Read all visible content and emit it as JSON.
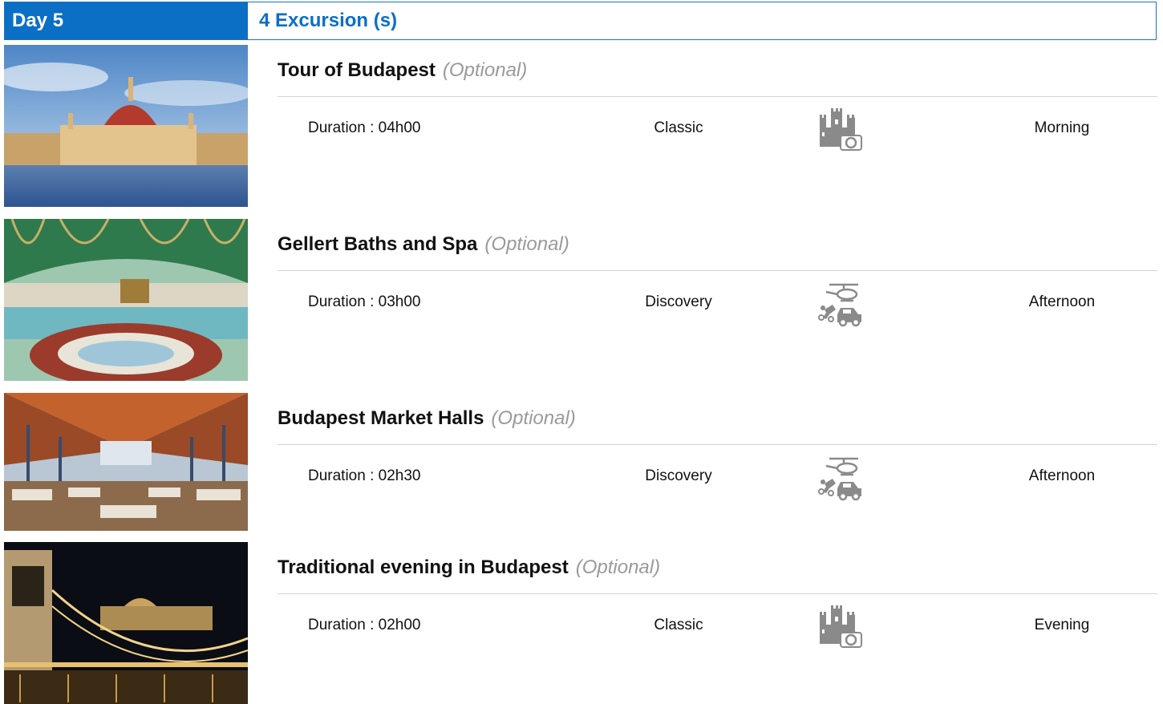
{
  "header": {
    "day_label": "Day 5",
    "excursion_count": "4 Excursion (s)"
  },
  "optional_label": "(Optional)",
  "excursions": [
    {
      "title": "Tour of Budapest",
      "optional": "(Optional)",
      "duration": "Duration : 04h00",
      "category": "Classic",
      "category_icon": "castle-camera-icon",
      "period": "Morning"
    },
    {
      "title": "Gellert Baths and Spa",
      "optional": "(Optional)",
      "duration": "Duration : 03h00",
      "category": "Discovery",
      "category_icon": "helicopter-car-icon",
      "period": "Afternoon"
    },
    {
      "title": "Budapest Market Halls",
      "optional": "(Optional)",
      "duration": "Duration : 02h30",
      "category": "Discovery",
      "category_icon": "helicopter-car-icon",
      "period": "Afternoon"
    },
    {
      "title": "Traditional evening in Budapest",
      "optional": "(Optional)",
      "duration": "Duration : 02h00",
      "category": "Classic",
      "category_icon": "castle-camera-icon",
      "period": "Evening"
    }
  ],
  "colors": {
    "accent": "#0b6fc6",
    "optional_text": "#9a9a9a",
    "divider": "#d3d3d3",
    "icon_gray": "#8a8a8a"
  }
}
